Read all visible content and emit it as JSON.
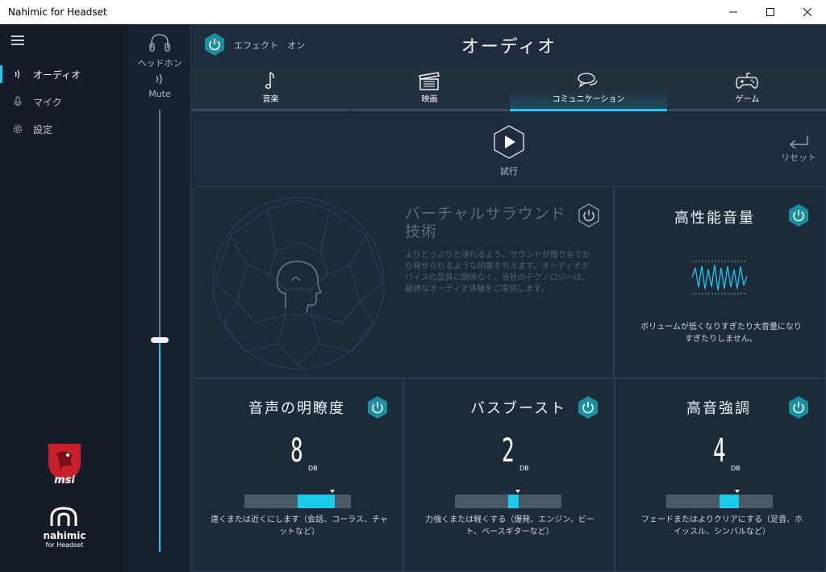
{
  "window": {
    "title": "Nahimic for Headset"
  },
  "nav": {
    "items": [
      {
        "label": "オーディオ",
        "icon": "sound-wave-icon",
        "active": true
      },
      {
        "label": "マイク",
        "icon": "microphone-icon",
        "active": false
      },
      {
        "label": "設定",
        "icon": "gear-icon",
        "active": false
      }
    ],
    "brand_msi": "msi",
    "brand_nahimic": "nahimic",
    "brand_nahimic_sub": "for Headset"
  },
  "volume": {
    "device_label": "ヘッドホン",
    "mute_label": "Mute",
    "level_fraction": 0.48
  },
  "header": {
    "effect_label": "エフェクト　オン",
    "title": "オーディオ"
  },
  "tabs": [
    {
      "label": "音楽",
      "icon": "music-note-icon",
      "active": false
    },
    {
      "label": "映画",
      "icon": "clapperboard-icon",
      "active": false
    },
    {
      "label": "コミュニケーション",
      "icon": "chat-bubbles-icon",
      "active": true
    },
    {
      "label": "ゲーム",
      "icon": "gamepad-icon",
      "active": false
    }
  ],
  "controls": {
    "test_label": "試行",
    "reset_label": "リセット"
  },
  "surround": {
    "title": "バーチャルサラウンド技術",
    "description": "よりどっぷりと浸れるよう、サウンドが周り全てから発せられるような印象を与えます。オーディオデバイスの品質に関係なく、当社のテクノロジーは、最適なオーディオ体験をご提供します。",
    "enabled": false
  },
  "volume_stabilizer": {
    "title": "高性能音量",
    "description": "ボリュームが低くなりすぎたり大音量になりすぎたりしません。",
    "enabled": true
  },
  "voice_clarity": {
    "title": "音声の明瞭度",
    "value": "8",
    "unit": "DB",
    "level_fraction": 0.85,
    "description": "遠くまたは近くにします（会話、コーラス、チャットなど）",
    "enabled": true
  },
  "bass_boost": {
    "title": "バスブースト",
    "value": "2",
    "unit": "DB",
    "level_fraction": 0.6,
    "description": "力強くまたは軽くする（爆発、エンジン、ビート、ベースギターなど）",
    "enabled": true
  },
  "treble": {
    "title": "高音強調",
    "value": "4",
    "unit": "DB",
    "level_fraction": 0.68,
    "description": "フェードまたはよりクリアにする（足音、ホイッスル、シンバルなど）",
    "enabled": true
  },
  "colors": {
    "accent": "#1ec8e8",
    "background": "#1e2c3d",
    "sidebar": "#141c27"
  }
}
